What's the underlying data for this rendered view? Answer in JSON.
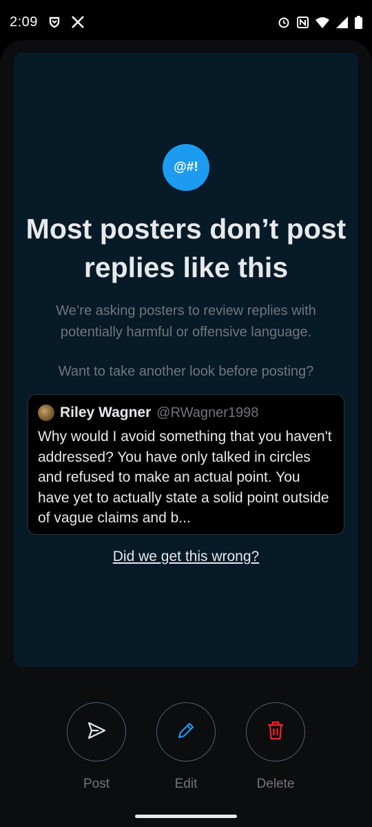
{
  "status_bar": {
    "time": "2:09",
    "left_icons": [
      "shield-icon",
      "x-logo-icon"
    ],
    "right_icons": [
      "alarm-icon",
      "nfc-icon",
      "wifi-icon",
      "signal-icon",
      "battery-icon"
    ]
  },
  "prompt": {
    "badge_text": "@#!",
    "headline": "Most posters don’t post replies like this",
    "subtext": "We’re asking posters to review replies with potentially harmful or offensive language.",
    "question": "Want to take another look before posting?",
    "feedback_link": "Did we get this wrong?"
  },
  "quoted_post": {
    "author_name": "Riley Wagner",
    "author_handle": "@RWagner1998",
    "text": "Why would I avoid something that you haven't addressed? You have only talked in circles and refused to make an actual point. You have yet to actually state a solid point outside of vague claims and b..."
  },
  "actions": {
    "post": {
      "label": "Post",
      "icon": "send-icon"
    },
    "edit": {
      "label": "Edit",
      "icon": "pencil-icon",
      "color": "#1d9bf0"
    },
    "delete": {
      "label": "Delete",
      "icon": "trash-icon",
      "color": "#f4212e"
    }
  },
  "colors": {
    "accent": "#1d9bf0",
    "card_background": "#061a27",
    "muted_text": "#71767b"
  }
}
